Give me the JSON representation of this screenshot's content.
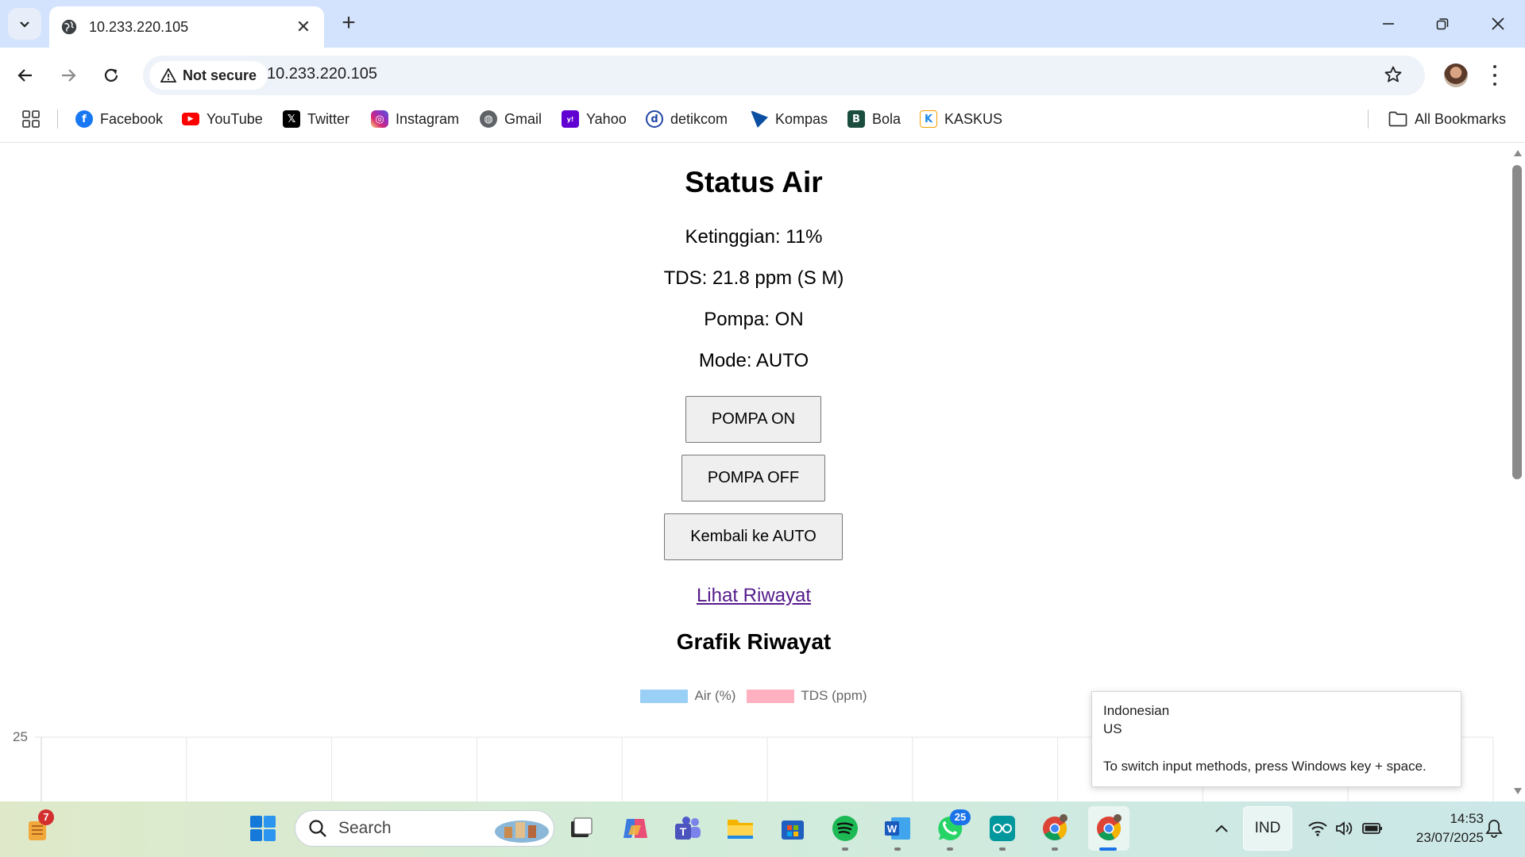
{
  "browser": {
    "tab_title": "10.233.220.105",
    "security_label": "Not secure",
    "url": "10.233.220.105"
  },
  "bookmarks": [
    {
      "label": "Facebook",
      "icon": "facebook-icon",
      "color": "#1877f2"
    },
    {
      "label": "YouTube",
      "icon": "youtube-icon",
      "color": "#ff0000"
    },
    {
      "label": "Twitter",
      "icon": "x-icon",
      "color": "#000000"
    },
    {
      "label": "Instagram",
      "icon": "instagram-icon",
      "color": "#d62976"
    },
    {
      "label": "Gmail",
      "icon": "globe-icon",
      "color": "#5f6368"
    },
    {
      "label": "Yahoo",
      "icon": "yahoo-icon",
      "color": "#6001d2"
    },
    {
      "label": "detikcom",
      "icon": "detik-icon",
      "color": "#2146a6"
    },
    {
      "label": "Kompas",
      "icon": "kompas-icon",
      "color": "#0b4ea2"
    },
    {
      "label": "Bola",
      "icon": "bola-icon",
      "color": "#1b4d3e"
    },
    {
      "label": "KASKUS",
      "icon": "kaskus-icon",
      "color": "#1e88e5"
    }
  ],
  "all_bookmarks_label": "All Bookmarks",
  "page": {
    "title": "Status Air",
    "status_lines": [
      "Ketinggian: 11%",
      "TDS: 21.8 ppm (S M)",
      "Pompa: ON",
      "Mode: AUTO"
    ],
    "buttons": {
      "pump_on": "POMPA ON",
      "pump_off": "POMPA OFF",
      "auto": "Kembali ke AUTO"
    },
    "history_link": "Lihat Riwayat",
    "chart_title": "Grafik Riwayat"
  },
  "chart_data": {
    "type": "bar",
    "series": [
      {
        "name": "Air (%)",
        "color": "#9ad0f5"
      },
      {
        "name": "TDS (ppm)",
        "color": "#ffb1c1"
      }
    ],
    "y_ticks_visible": [
      "25"
    ],
    "grid": true,
    "legend": "top-center"
  },
  "ime_tooltip": {
    "language": "Indonesian",
    "layout": "US",
    "hint": "To switch input methods, press Windows key + space."
  },
  "taskbar": {
    "search_placeholder": "Search",
    "widget_badge": "7",
    "whatsapp_badge": "25",
    "input_indicator": "IND",
    "time": "14:53",
    "date": "23/07/2025"
  }
}
